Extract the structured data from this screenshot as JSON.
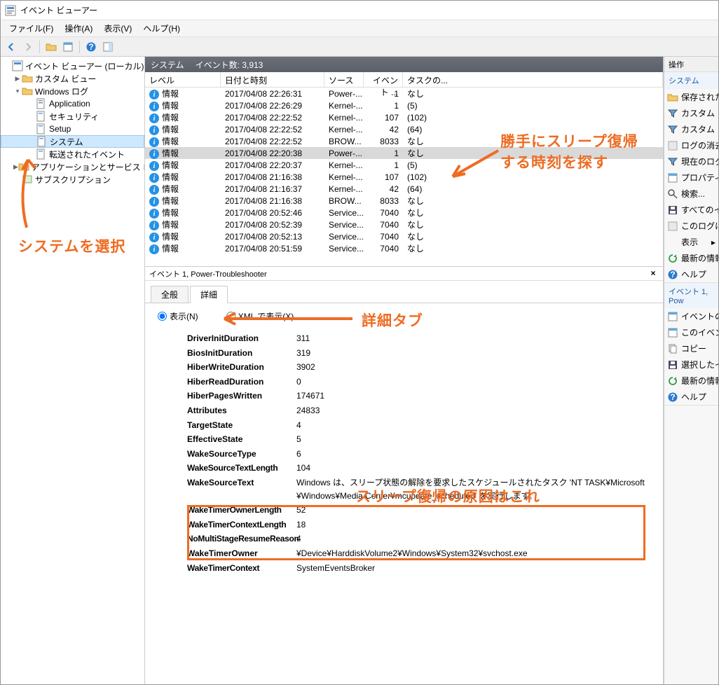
{
  "window": {
    "title": "イベント ビューアー"
  },
  "menu": {
    "file": "ファイル(F)",
    "action": "操作(A)",
    "view": "表示(V)",
    "help": "ヘルプ(H)"
  },
  "tree": {
    "root": "イベント ビューアー (ローカル)",
    "custom": "カスタム ビュー",
    "winlog": "Windows ログ",
    "items": {
      "app": "Application",
      "sec": "セキュリティ",
      "setup": "Setup",
      "sys": "システム",
      "fwd": "転送されたイベント"
    },
    "appserv": "アプリケーションとサービス ログ",
    "sub": "サブスクリプション"
  },
  "grid": {
    "header_label": "システム",
    "header_count_label": "イベント数:",
    "header_count": "3,913",
    "cols": {
      "level": "レベル",
      "date": "日付と時刻",
      "src": "ソース",
      "id": "イベント ...",
      "cat": "タスクの..."
    },
    "rows": [
      {
        "level": "情報",
        "date": "2017/04/08 22:26:31",
        "src": "Power-...",
        "id": "1",
        "cat": "なし"
      },
      {
        "level": "情報",
        "date": "2017/04/08 22:26:29",
        "src": "Kernel-...",
        "id": "1",
        "cat": "(5)"
      },
      {
        "level": "情報",
        "date": "2017/04/08 22:22:52",
        "src": "Kernel-...",
        "id": "107",
        "cat": "(102)"
      },
      {
        "level": "情報",
        "date": "2017/04/08 22:22:52",
        "src": "Kernel-...",
        "id": "42",
        "cat": "(64)"
      },
      {
        "level": "情報",
        "date": "2017/04/08 22:22:52",
        "src": "BROW...",
        "id": "8033",
        "cat": "なし"
      },
      {
        "level": "情報",
        "date": "2017/04/08 22:20:38",
        "src": "Power-...",
        "id": "1",
        "cat": "なし",
        "sel": true
      },
      {
        "level": "情報",
        "date": "2017/04/08 22:20:37",
        "src": "Kernel-...",
        "id": "1",
        "cat": "(5)"
      },
      {
        "level": "情報",
        "date": "2017/04/08 21:16:38",
        "src": "Kernel-...",
        "id": "107",
        "cat": "(102)"
      },
      {
        "level": "情報",
        "date": "2017/04/08 21:16:37",
        "src": "Kernel-...",
        "id": "42",
        "cat": "(64)"
      },
      {
        "level": "情報",
        "date": "2017/04/08 21:16:38",
        "src": "BROW...",
        "id": "8033",
        "cat": "なし"
      },
      {
        "level": "情報",
        "date": "2017/04/08 20:52:46",
        "src": "Service...",
        "id": "7040",
        "cat": "なし"
      },
      {
        "level": "情報",
        "date": "2017/04/08 20:52:39",
        "src": "Service...",
        "id": "7040",
        "cat": "なし"
      },
      {
        "level": "情報",
        "date": "2017/04/08 20:52:13",
        "src": "Service...",
        "id": "7040",
        "cat": "なし"
      },
      {
        "level": "情報",
        "date": "2017/04/08 20:51:59",
        "src": "Service...",
        "id": "7040",
        "cat": "なし"
      }
    ]
  },
  "detail": {
    "header": "イベント 1, Power-Troubleshooter",
    "tabs": {
      "general": "全般",
      "detail": "詳細"
    },
    "radio": {
      "friendly": "表示(N)",
      "xml": "XML で表示(X)"
    },
    "props": [
      {
        "k": "DriverInitDuration",
        "v": "311"
      },
      {
        "k": "BiosInitDuration",
        "v": "319"
      },
      {
        "k": "HiberWriteDuration",
        "v": "3902"
      },
      {
        "k": "HiberReadDuration",
        "v": "0"
      },
      {
        "k": "HiberPagesWritten",
        "v": "174671"
      },
      {
        "k": "Attributes",
        "v": "24833"
      },
      {
        "k": "TargetState",
        "v": "4"
      },
      {
        "k": "EffectiveState",
        "v": "5"
      },
      {
        "k": "WakeSourceType",
        "v": "6"
      },
      {
        "k": "WakeSourceTextLength",
        "v": "104",
        "tight": true
      },
      {
        "k": "WakeSourceText",
        "v": "Windows は、スリープ状態の解除を要求したスケジュールされたタスク 'NT TASK¥Microsoft¥Windows¥Media Center¥mcupdate_scheduled' を実行します。"
      },
      {
        "k": "WakeTimerOwnerLength",
        "v": "52",
        "tight": true
      },
      {
        "k": "WakeTimerContextLength",
        "v": "18",
        "tight": true
      },
      {
        "k": "NoMultiStageResumeReason",
        "v": "4",
        "tight": true
      },
      {
        "k": "WakeTimerOwner",
        "v": "¥Device¥HarddiskVolume2¥Windows¥System32¥svchost.exe"
      },
      {
        "k": "WakeTimerContext",
        "v": "SystemEventsBroker",
        "tight": true
      }
    ]
  },
  "actions": {
    "header": "操作",
    "sec1_title": "システム",
    "sec1": [
      "保存された",
      "カスタム ビ",
      "カスタム ビ",
      "ログの消去",
      "現在のログ",
      "プロパティ",
      "検索...",
      "すべてのイ",
      "このログに"
    ],
    "view": "表示",
    "sec1b": [
      "最新の情報",
      "ヘルプ"
    ],
    "sec2_title": "イベント 1, Pow",
    "sec2": [
      "イベントの",
      "このイベント",
      "コピー",
      "選択したイ",
      "最新の情報",
      "ヘルプ"
    ]
  },
  "annotations": {
    "select_system": "システムを選択",
    "find_time": "勝手にスリープ復帰\nする時刻を探す",
    "detail_tab": "詳細タブ",
    "cause": "スリープ復帰の原因はこれ"
  }
}
